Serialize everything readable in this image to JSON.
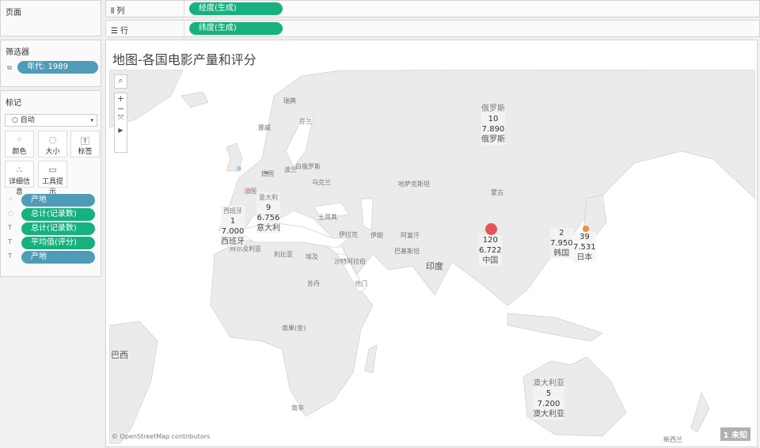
{
  "pages": {
    "title": "页面"
  },
  "shelves": {
    "columns": {
      "label": "列",
      "pill": "经度(生成)",
      "icon": "columns-icon"
    },
    "rows": {
      "label": "行",
      "pill": "纬度(生成)",
      "icon": "rows-icon"
    }
  },
  "filters": {
    "title": "筛选器",
    "items": [
      {
        "label": "年代: 1989"
      }
    ]
  },
  "marks": {
    "title": "标记",
    "type": "自动",
    "cards": [
      {
        "label": "颜色",
        "icon": "color-icon"
      },
      {
        "label": "大小",
        "icon": "size-icon"
      },
      {
        "label": "标签",
        "icon": "label-icon"
      },
      {
        "label": "详细信息",
        "icon": "detail-icon"
      },
      {
        "label": "工具提示",
        "icon": "tooltip-icon"
      }
    ],
    "fields": [
      {
        "label": "产地",
        "icon": "color-icon"
      },
      {
        "label": "总计(记录数)",
        "icon": "size-icon"
      },
      {
        "label": "总计(记录数)",
        "icon": "label-icon"
      },
      {
        "label": "平均值(评分)",
        "icon": "label-icon"
      },
      {
        "label": "产地",
        "icon": "label-icon"
      }
    ]
  },
  "view": {
    "title": "地图-各国电影产量和评分",
    "attribution": "© OpenStreetMap contributors",
    "unknown_badge": "1 未知"
  },
  "map": {
    "country_labels": [
      "瑞典",
      "芬兰",
      "挪威",
      "白俄罗斯",
      "波兰",
      "乌克兰",
      "德国",
      "法国",
      "土耳其",
      "伊拉克",
      "伊朗",
      "哈萨克斯坦",
      "蒙古",
      "阿富汗",
      "巴基斯坦",
      "印度",
      "阿尔及利亚",
      "利比亚",
      "埃及",
      "沙特阿拉伯",
      "也门",
      "苏丹",
      "南果(金)",
      "南非",
      "巴西",
      "新西兰",
      "俄罗斯",
      "澳大利亚",
      "西班牙",
      "意大利"
    ],
    "points": [
      {
        "country": "中国",
        "count": "120",
        "rating": "6.722",
        "color": "#e15759"
      },
      {
        "country": "日本",
        "count": "39",
        "rating": "7.531",
        "color": "#f28e2b"
      },
      {
        "country": "俄罗斯",
        "count": "10",
        "rating": "7.890",
        "color": "#76b7b2"
      },
      {
        "country": "意大利",
        "count": "9",
        "rating": "6.756",
        "color": "#59a14f"
      },
      {
        "country": "澳大利亚",
        "count": "5",
        "rating": "7.200",
        "color": "#edc948"
      },
      {
        "country": "韩国",
        "count": "2",
        "rating": "7.950",
        "color": "#b07aa1"
      },
      {
        "country": "西班牙",
        "count": "1",
        "rating": "7.000",
        "color": "#ff9da7"
      }
    ],
    "unlabeled_marks": [
      {
        "color": "#a0cbe8"
      },
      {
        "color": "#ff9da7"
      },
      {
        "color": "#499894"
      }
    ]
  }
}
